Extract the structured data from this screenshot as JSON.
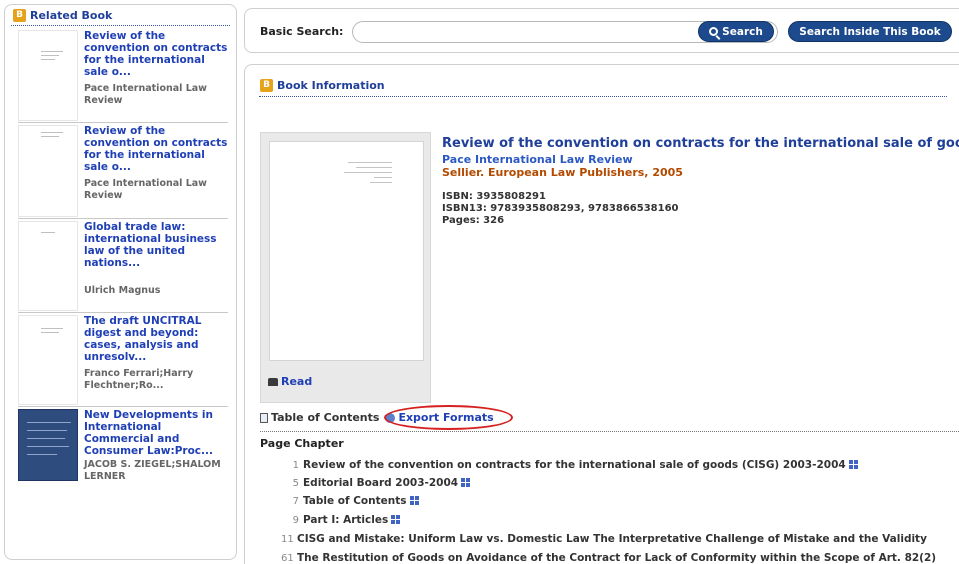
{
  "sidebar": {
    "title": "Related Book",
    "items": [
      {
        "title": "Review of the convention on contracts for the international sale o...",
        "author": "Pace International Law Review"
      },
      {
        "title": "Review of the convention on contracts for the international sale o...",
        "author": "Pace International Law Review"
      },
      {
        "title": "Global trade law: international business law of the united nations...",
        "author": "Ulrich Magnus"
      },
      {
        "title": "The draft UNCITRAL digest and beyond: cases, analysis and unresolv...",
        "author": "Franco Ferrari;Harry Flechtner;Ro..."
      },
      {
        "title": "New Developments in International Commercial and Consumer Law:Proc...",
        "author": "JACOB S. ZIEGEL;SHALOM LERNER"
      }
    ]
  },
  "search": {
    "label": "Basic Search:",
    "value": "",
    "search_button": "Search",
    "inside_button": "Search Inside This Book"
  },
  "book": {
    "section_title": "Book Information",
    "title": "Review of the convention on contracts for the international sale of goods",
    "journal": "Pace International Law Review",
    "publisher": "Sellier. European Law Publishers, 2005",
    "isbn": "ISBN: 3935808291",
    "isbn13": "ISBN13: 9783935808293, 9783866538160",
    "pages": "Pages: 326",
    "read_link": "Read"
  },
  "tabs": {
    "toc": "Table of Contents",
    "export": "Export Formats"
  },
  "chapters": {
    "header": "Page Chapter",
    "rows": [
      {
        "page": "1",
        "title": "Review of the convention on contracts for the international sale of goods (CISG) 2003-2004"
      },
      {
        "page": "5",
        "title": "Editorial Board 2003-2004"
      },
      {
        "page": "7",
        "title": "Table of Contents"
      },
      {
        "page": "9",
        "title": "Part I: Articles"
      },
      {
        "page": "11",
        "title": "CISG and Mistake: Uniform Law vs. Domestic Law The Interpretative Challenge of Mistake and the Validity"
      },
      {
        "page": "61",
        "title": "The Restitution of Goods on Avoidance of the Contract for Lack of Conformity within the Scope of Art. 82(2)"
      }
    ]
  },
  "colors": {
    "accent": "#1d4a8c",
    "link": "#1f3fb5",
    "publisher": "#b34a00",
    "highlight_ring": "#d62020"
  }
}
